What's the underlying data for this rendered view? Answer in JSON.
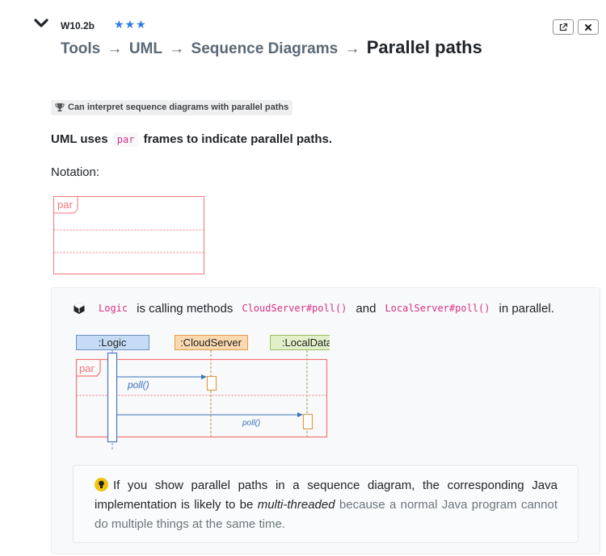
{
  "header": {
    "section_id": "W10.2b",
    "stars": "★★★",
    "breadcrumb": [
      "Tools",
      "UML",
      "Sequence Diagrams"
    ],
    "arrow": "→",
    "current": "Parallel paths",
    "buttons": [
      "external-link-icon",
      "close-icon"
    ]
  },
  "outcome": {
    "text": "Can interpret sequence diagrams with parallel paths"
  },
  "lead": {
    "before": "UML uses",
    "code": "par",
    "after": "frames to indicate parallel paths."
  },
  "notation": {
    "label": "Notation:",
    "frame_label": "par"
  },
  "example": {
    "code1": "Logic",
    "text1": "is calling methods",
    "code2": "CloudServer#poll()",
    "text2": "and",
    "code3": "LocalServer#poll()",
    "text3": "in parallel.",
    "diagram": {
      "lifelines": [
        ":Logic",
        ":CloudServer",
        ":LocalData"
      ],
      "frame_label": "par",
      "message1": "poll()",
      "message2": "poll()"
    }
  },
  "tip": {
    "text_before": "If you show parallel paths in a sequence diagram, the corresponding Java implementation is likely to be",
    "emphasis": "multi-threaded",
    "text_after": "because a normal Java program cannot do multiple things at the same time."
  },
  "colors": {
    "frame_red": "#f2767a",
    "logic_blue": "#c6dbf5",
    "cloud_orange": "#fbd9b0",
    "local_green": "#e2f0c9",
    "code_pink": "#d63384",
    "star_blue": "#2c7be5"
  }
}
